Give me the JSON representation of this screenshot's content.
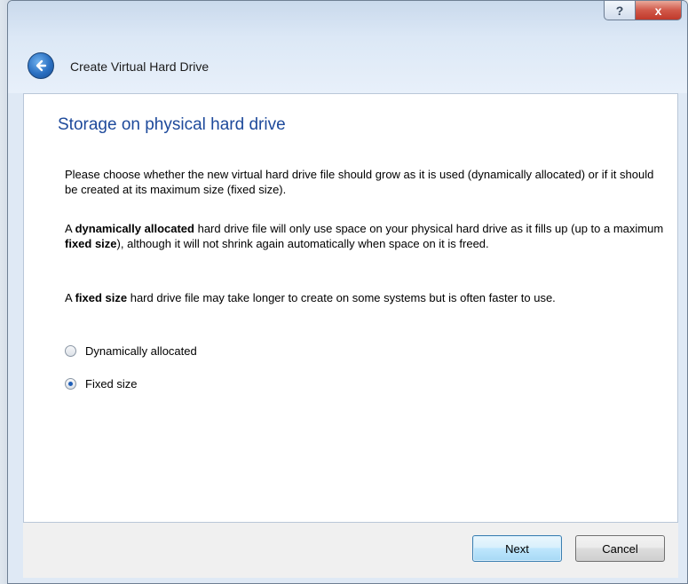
{
  "window": {
    "help_label": "?",
    "close_label": "x",
    "title": "Create Virtual Hard Drive"
  },
  "page": {
    "heading": "Storage on physical hard drive",
    "para1": "Please choose whether the new virtual hard drive file should grow as it is used (dynamically allocated) or if it should be created at its maximum size (fixed size).",
    "para2": {
      "t1": "A ",
      "b1": "dynamically allocated",
      "t2": " hard drive file will only use space on your physical hard drive as it fills up (up to a maximum ",
      "b2": "fixed size",
      "t3": "), although it will not shrink again automatically when space on it is freed."
    },
    "para3": {
      "t1": "A ",
      "b1": "fixed size",
      "t2": " hard drive file may take longer to create on some systems but is often faster to use."
    }
  },
  "options": [
    {
      "label": "Dynamically allocated",
      "checked": false
    },
    {
      "label": "Fixed size",
      "checked": true
    }
  ],
  "footer": {
    "next_label": "Next",
    "cancel_label": "Cancel"
  },
  "icons": {
    "back": "arrow-left-circle-icon",
    "help": "question-icon",
    "close": "close-icon"
  },
  "colors": {
    "heading": "#1e4a9b",
    "close_button": "#c0392b",
    "default_button_border": "#3c7fb1"
  }
}
